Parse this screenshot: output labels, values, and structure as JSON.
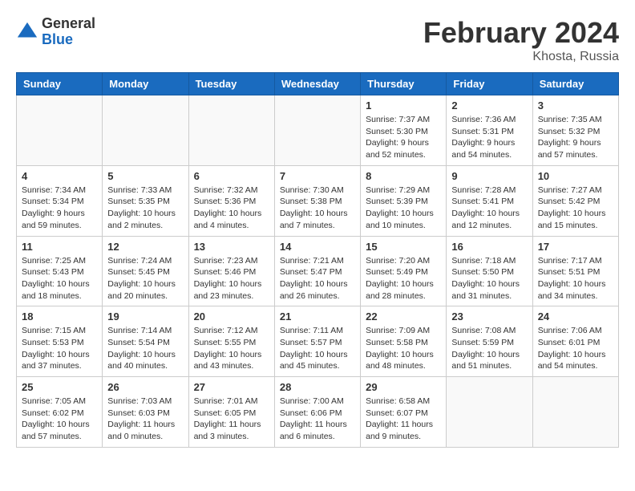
{
  "logo": {
    "general": "General",
    "blue": "Blue"
  },
  "title": {
    "month_year": "February 2024",
    "location": "Khosta, Russia"
  },
  "weekdays": [
    "Sunday",
    "Monday",
    "Tuesday",
    "Wednesday",
    "Thursday",
    "Friday",
    "Saturday"
  ],
  "weeks": [
    [
      {
        "day": "",
        "info": ""
      },
      {
        "day": "",
        "info": ""
      },
      {
        "day": "",
        "info": ""
      },
      {
        "day": "",
        "info": ""
      },
      {
        "day": "1",
        "info": "Sunrise: 7:37 AM\nSunset: 5:30 PM\nDaylight: 9 hours\nand 52 minutes."
      },
      {
        "day": "2",
        "info": "Sunrise: 7:36 AM\nSunset: 5:31 PM\nDaylight: 9 hours\nand 54 minutes."
      },
      {
        "day": "3",
        "info": "Sunrise: 7:35 AM\nSunset: 5:32 PM\nDaylight: 9 hours\nand 57 minutes."
      }
    ],
    [
      {
        "day": "4",
        "info": "Sunrise: 7:34 AM\nSunset: 5:34 PM\nDaylight: 9 hours\nand 59 minutes."
      },
      {
        "day": "5",
        "info": "Sunrise: 7:33 AM\nSunset: 5:35 PM\nDaylight: 10 hours\nand 2 minutes."
      },
      {
        "day": "6",
        "info": "Sunrise: 7:32 AM\nSunset: 5:36 PM\nDaylight: 10 hours\nand 4 minutes."
      },
      {
        "day": "7",
        "info": "Sunrise: 7:30 AM\nSunset: 5:38 PM\nDaylight: 10 hours\nand 7 minutes."
      },
      {
        "day": "8",
        "info": "Sunrise: 7:29 AM\nSunset: 5:39 PM\nDaylight: 10 hours\nand 10 minutes."
      },
      {
        "day": "9",
        "info": "Sunrise: 7:28 AM\nSunset: 5:41 PM\nDaylight: 10 hours\nand 12 minutes."
      },
      {
        "day": "10",
        "info": "Sunrise: 7:27 AM\nSunset: 5:42 PM\nDaylight: 10 hours\nand 15 minutes."
      }
    ],
    [
      {
        "day": "11",
        "info": "Sunrise: 7:25 AM\nSunset: 5:43 PM\nDaylight: 10 hours\nand 18 minutes."
      },
      {
        "day": "12",
        "info": "Sunrise: 7:24 AM\nSunset: 5:45 PM\nDaylight: 10 hours\nand 20 minutes."
      },
      {
        "day": "13",
        "info": "Sunrise: 7:23 AM\nSunset: 5:46 PM\nDaylight: 10 hours\nand 23 minutes."
      },
      {
        "day": "14",
        "info": "Sunrise: 7:21 AM\nSunset: 5:47 PM\nDaylight: 10 hours\nand 26 minutes."
      },
      {
        "day": "15",
        "info": "Sunrise: 7:20 AM\nSunset: 5:49 PM\nDaylight: 10 hours\nand 28 minutes."
      },
      {
        "day": "16",
        "info": "Sunrise: 7:18 AM\nSunset: 5:50 PM\nDaylight: 10 hours\nand 31 minutes."
      },
      {
        "day": "17",
        "info": "Sunrise: 7:17 AM\nSunset: 5:51 PM\nDaylight: 10 hours\nand 34 minutes."
      }
    ],
    [
      {
        "day": "18",
        "info": "Sunrise: 7:15 AM\nSunset: 5:53 PM\nDaylight: 10 hours\nand 37 minutes."
      },
      {
        "day": "19",
        "info": "Sunrise: 7:14 AM\nSunset: 5:54 PM\nDaylight: 10 hours\nand 40 minutes."
      },
      {
        "day": "20",
        "info": "Sunrise: 7:12 AM\nSunset: 5:55 PM\nDaylight: 10 hours\nand 43 minutes."
      },
      {
        "day": "21",
        "info": "Sunrise: 7:11 AM\nSunset: 5:57 PM\nDaylight: 10 hours\nand 45 minutes."
      },
      {
        "day": "22",
        "info": "Sunrise: 7:09 AM\nSunset: 5:58 PM\nDaylight: 10 hours\nand 48 minutes."
      },
      {
        "day": "23",
        "info": "Sunrise: 7:08 AM\nSunset: 5:59 PM\nDaylight: 10 hours\nand 51 minutes."
      },
      {
        "day": "24",
        "info": "Sunrise: 7:06 AM\nSunset: 6:01 PM\nDaylight: 10 hours\nand 54 minutes."
      }
    ],
    [
      {
        "day": "25",
        "info": "Sunrise: 7:05 AM\nSunset: 6:02 PM\nDaylight: 10 hours\nand 57 minutes."
      },
      {
        "day": "26",
        "info": "Sunrise: 7:03 AM\nSunset: 6:03 PM\nDaylight: 11 hours\nand 0 minutes."
      },
      {
        "day": "27",
        "info": "Sunrise: 7:01 AM\nSunset: 6:05 PM\nDaylight: 11 hours\nand 3 minutes."
      },
      {
        "day": "28",
        "info": "Sunrise: 7:00 AM\nSunset: 6:06 PM\nDaylight: 11 hours\nand 6 minutes."
      },
      {
        "day": "29",
        "info": "Sunrise: 6:58 AM\nSunset: 6:07 PM\nDaylight: 11 hours\nand 9 minutes."
      },
      {
        "day": "",
        "info": ""
      },
      {
        "day": "",
        "info": ""
      }
    ]
  ]
}
